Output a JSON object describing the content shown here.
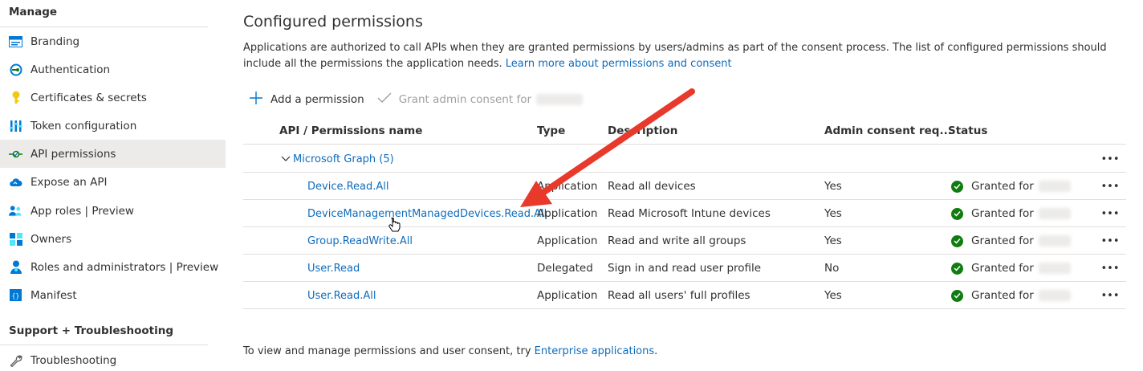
{
  "sidebar": {
    "manage_header": "Manage",
    "items": [
      {
        "label": "Branding",
        "icon": "branding-icon"
      },
      {
        "label": "Authentication",
        "icon": "authentication-icon"
      },
      {
        "label": "Certificates & secrets",
        "icon": "key-icon"
      },
      {
        "label": "Token configuration",
        "icon": "token-icon"
      },
      {
        "label": "API permissions",
        "icon": "api-permissions-icon",
        "selected": true
      },
      {
        "label": "Expose an API",
        "icon": "cloud-icon"
      },
      {
        "label": "App roles | Preview",
        "icon": "app-roles-icon"
      },
      {
        "label": "Owners",
        "icon": "owners-icon"
      },
      {
        "label": "Roles and administrators | Preview",
        "icon": "roles-icon"
      },
      {
        "label": "Manifest",
        "icon": "manifest-icon"
      }
    ],
    "support_header": "Support + Troubleshooting",
    "support_items": [
      {
        "label": "Troubleshooting",
        "icon": "wrench-icon"
      }
    ]
  },
  "main": {
    "title": "Configured permissions",
    "description": "Applications are authorized to call APIs when they are granted permissions by users/admins as part of the consent process. The list of configured permissions should include all the permissions the application needs.",
    "learn_more": "Learn more about permissions and consent",
    "toolbar": {
      "add_label": "Add a permission",
      "grant_label": "Grant admin consent for"
    },
    "table": {
      "headers": [
        "API / Permissions name",
        "Type",
        "Description",
        "Admin consent req...",
        "Status"
      ],
      "group": "Microsoft Graph (5)",
      "rows": [
        {
          "name": "Device.Read.All",
          "type": "Application",
          "description": "Read all devices",
          "admin": "Yes",
          "status": "Granted for"
        },
        {
          "name": "DeviceManagementManagedDevices.Read.All",
          "type": "Application",
          "description": "Read Microsoft Intune devices",
          "admin": "Yes",
          "status": "Granted for"
        },
        {
          "name": "Group.ReadWrite.All",
          "type": "Application",
          "description": "Read and write all groups",
          "admin": "Yes",
          "status": "Granted for"
        },
        {
          "name": "User.Read",
          "type": "Delegated",
          "description": "Sign in and read user profile",
          "admin": "No",
          "status": "Granted for"
        },
        {
          "name": "User.Read.All",
          "type": "Application",
          "description": "Read all users' full profiles",
          "admin": "Yes",
          "status": "Granted for"
        }
      ],
      "more_label": "•••"
    },
    "footer_text": "To view and manage permissions and user consent, try",
    "footer_link": "Enterprise applications",
    "footer_period": "."
  },
  "colors": {
    "link": "#0f6cbd",
    "status_green": "#107c10",
    "arrow_red": "#e8392b",
    "selected_bg": "#edebe9"
  }
}
